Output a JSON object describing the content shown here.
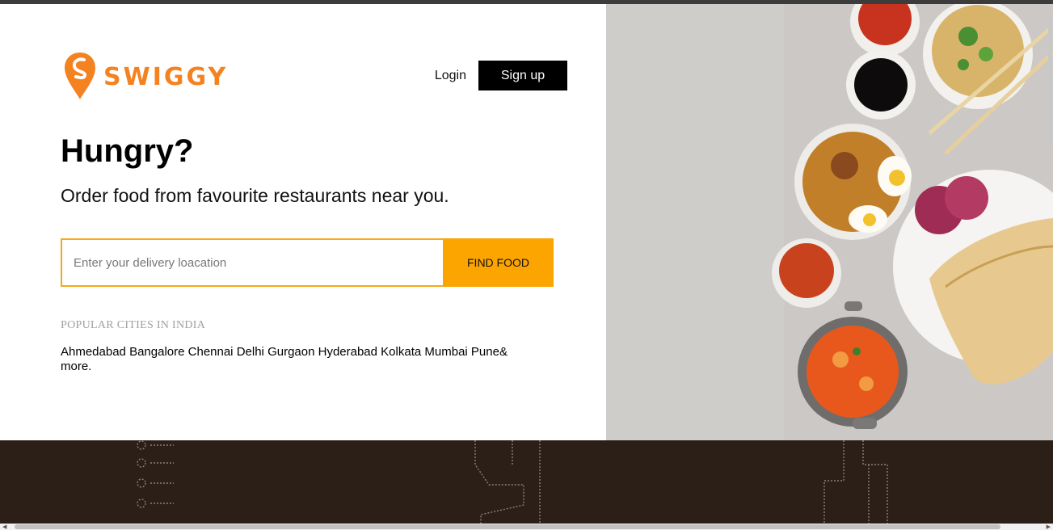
{
  "brand": {
    "name": "SWIGGY",
    "logo_icon": "swiggy-logo-icon",
    "accent_color": "#f58220"
  },
  "nav": {
    "login_label": "Login",
    "signup_label": "Sign up"
  },
  "hero": {
    "headline": "Hungry?",
    "subheadline": "Order food from favourite restaurants near you.",
    "search": {
      "placeholder": "Enter your delivery loacation",
      "value": "",
      "button_label": "FIND FOOD",
      "button_color": "#fca400"
    },
    "popular_cities": {
      "label": "POPULAR CITIES IN INDIA",
      "cities": [
        "Ahmedabad",
        "Bangalore",
        "Chennai",
        "Delhi",
        "Gurgaon",
        "Hyderabad",
        "Kolkata",
        "Mumbai",
        "Pune"
      ],
      "more_label": "& more."
    }
  },
  "footer_band_color": "#2b1f18",
  "scrollbar": {
    "left_icon": "scroll-left-arrow-icon",
    "right_icon": "scroll-right-arrow-icon"
  }
}
